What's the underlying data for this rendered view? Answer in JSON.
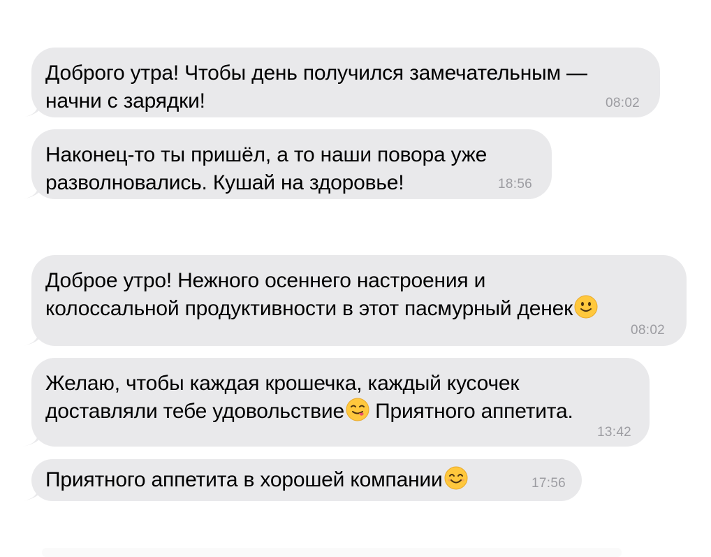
{
  "messages": [
    {
      "lines": [
        "Доброго утра! Чтобы день получился замечательным —",
        "начни с зарядки!"
      ],
      "time": "08:02"
    },
    {
      "lines": [
        "Наконец-то ты пришёл, а то наши повора уже",
        "разволновались. Кушай на здоровье!"
      ],
      "time": "18:56"
    },
    {
      "lines": [
        "Доброе утро! Нежного осеннего настроения и",
        "колоссальной продуктивности в этот пасмурный денек"
      ],
      "emoji": "slightly-smiling-face-icon",
      "time": "08:02"
    },
    {
      "lines": [
        "Желаю, чтобы каждая крошечка, каждый кусочек",
        "доставляли тебе удовольствие"
      ],
      "emoji": "face-savoring-food-icon",
      "line_tail": " Приятного аппетита.",
      "time": "13:42"
    },
    {
      "lines": [
        "Приятного аппетита в хорошей компании"
      ],
      "emoji": "smiling-face-with-smiling-eyes-icon",
      "time": "17:56"
    }
  ],
  "colors": {
    "bubble": "#e9e9eb",
    "text": "#000000",
    "timestamp": "#9c9ca1",
    "emoji_face": "#ffc83d"
  }
}
